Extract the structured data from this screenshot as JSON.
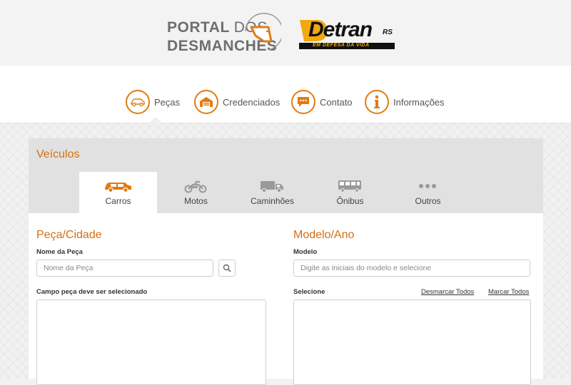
{
  "header": {
    "portal_line1": "PORTAL",
    "portal_line1b": "DOS",
    "portal_line2": "DESMANCHES",
    "detran_word": "Detran",
    "detran_suffix": "RS",
    "detran_tagline": "EM DEFESA DA VIDA"
  },
  "nav": {
    "items": [
      {
        "label": "Peças",
        "icon": "car-parts-icon"
      },
      {
        "label": "Credenciados",
        "icon": "garage-icon"
      },
      {
        "label": "Contato",
        "icon": "chat-icon"
      },
      {
        "label": "Informações",
        "icon": "info-icon"
      }
    ]
  },
  "vehicles": {
    "title": "Veículos",
    "tabs": [
      {
        "label": "Carros",
        "icon": "car-icon",
        "active": true
      },
      {
        "label": "Motos",
        "icon": "motorcycle-icon"
      },
      {
        "label": "Caminhões",
        "icon": "truck-icon"
      },
      {
        "label": "Ônibus",
        "icon": "bus-icon"
      },
      {
        "label": "Outros",
        "icon": "dots-icon"
      }
    ]
  },
  "part_section": {
    "title": "Peça/Cidade",
    "field_label": "Nome da Peça",
    "placeholder": "Nome da Peça",
    "list_label": "Campo peça deve ser selecionado"
  },
  "model_section": {
    "title": "Modelo/Ano",
    "field_label": "Modelo",
    "placeholder": "Digite as iniciais do modelo e selecione",
    "list_label": "Selecione",
    "deselect_all": "Desmarcar Todos",
    "select_all": "Marcar Todos"
  },
  "colors": {
    "accent": "#e07b12",
    "title": "#d46f12",
    "icon_gray": "#9a9a9a"
  }
}
